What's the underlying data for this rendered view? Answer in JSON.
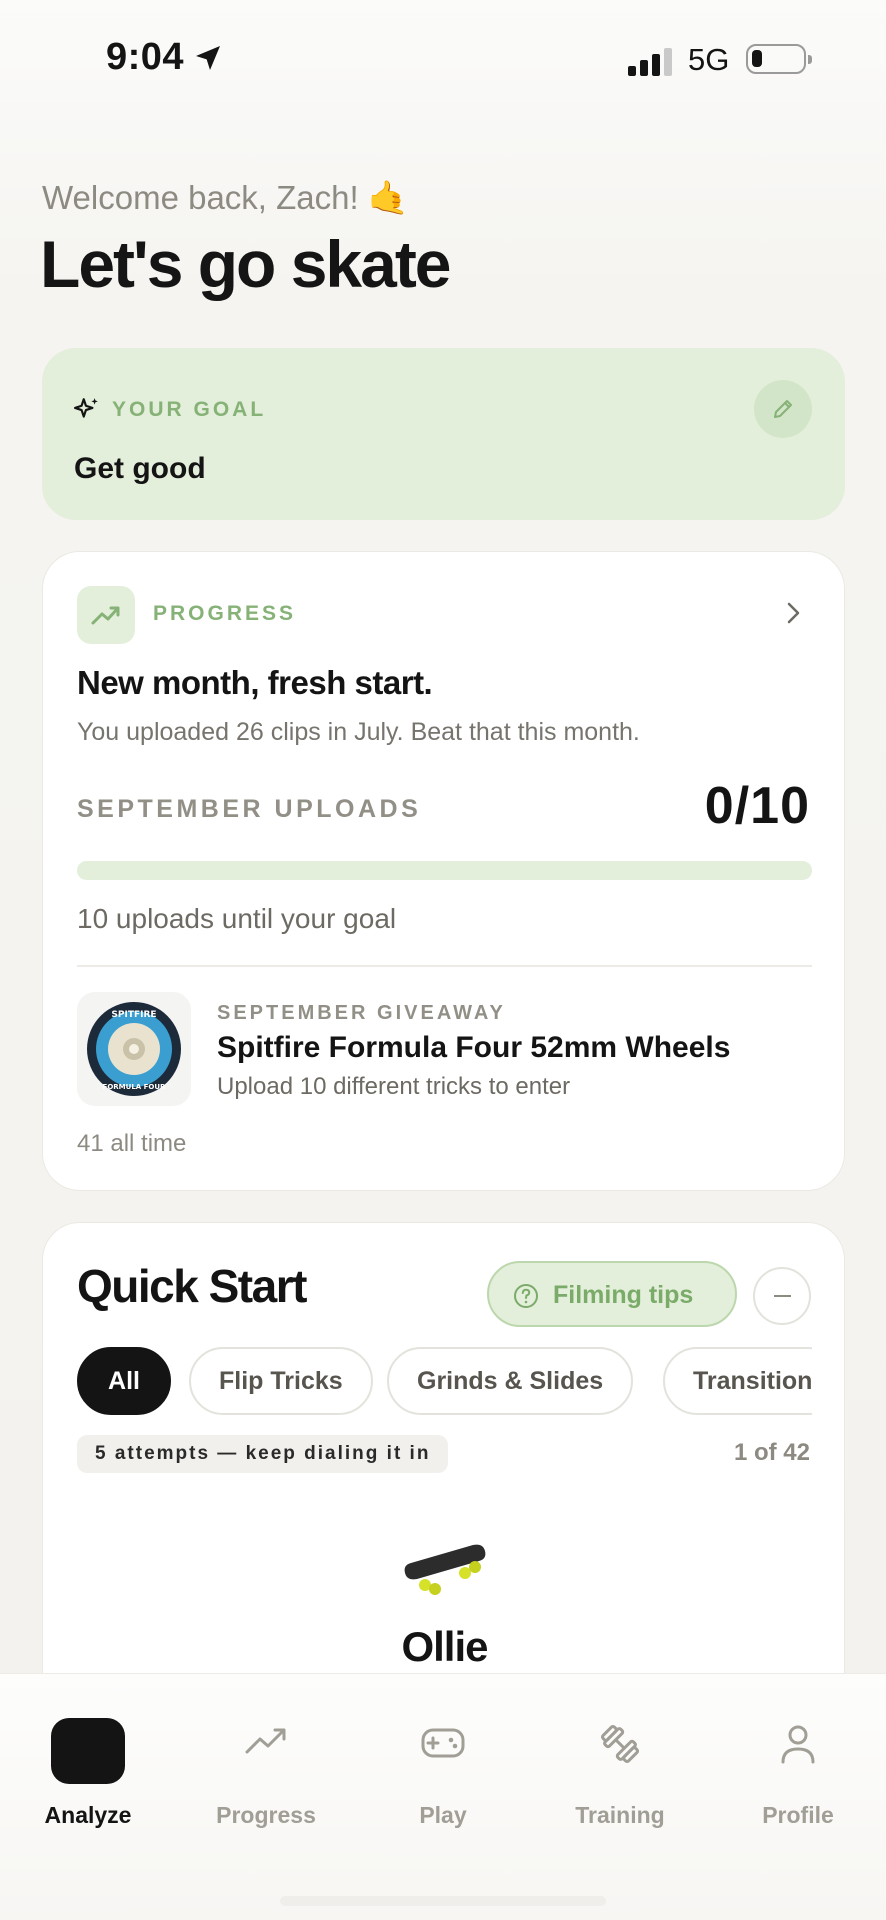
{
  "status_bar": {
    "time": "9:04",
    "network": "5G"
  },
  "header": {
    "welcome": "Welcome back, Zach!",
    "welcome_emoji": "🤙",
    "headline": "Let's go skate"
  },
  "goal": {
    "label": "YOUR GOAL",
    "value": "Get good"
  },
  "progress": {
    "label": "PROGRESS",
    "title": "New month, fresh start.",
    "subtitle": "You uploaded 26 clips in July. Beat that this month.",
    "month_label": "SEPTEMBER UPLOADS",
    "count": "0/10",
    "fill_fraction": 0,
    "until_goal": "10 uploads until your goal",
    "giveaway": {
      "label": "SEPTEMBER GIVEAWAY",
      "title": "Spitfire Formula Four 52mm Wheels",
      "subtitle": "Upload 10 different tricks to enter"
    },
    "all_time": "41 all time"
  },
  "quick_start": {
    "title": "Quick Start",
    "tips_label": "Filming tips",
    "filters": [
      "All",
      "Flip Tricks",
      "Grinds & Slides",
      "Transition"
    ],
    "attempts_badge": "5 attempts — keep dialing it in",
    "pager": "1 of 42",
    "trick_name": "Ollie"
  },
  "tab_bar": {
    "tabs": [
      {
        "label": "Analyze",
        "icon": "analyze-icon",
        "active": true
      },
      {
        "label": "Progress",
        "icon": "trend-icon",
        "active": false
      },
      {
        "label": "Play",
        "icon": "gamepad-icon",
        "active": false
      },
      {
        "label": "Training",
        "icon": "dumbbell-icon",
        "active": false
      },
      {
        "label": "Profile",
        "icon": "person-icon",
        "active": false
      }
    ]
  },
  "colors": {
    "accent_green": "#86b277",
    "goal_bg": "#e3efda",
    "text_dark": "#141414",
    "text_muted": "#8d8a82"
  }
}
